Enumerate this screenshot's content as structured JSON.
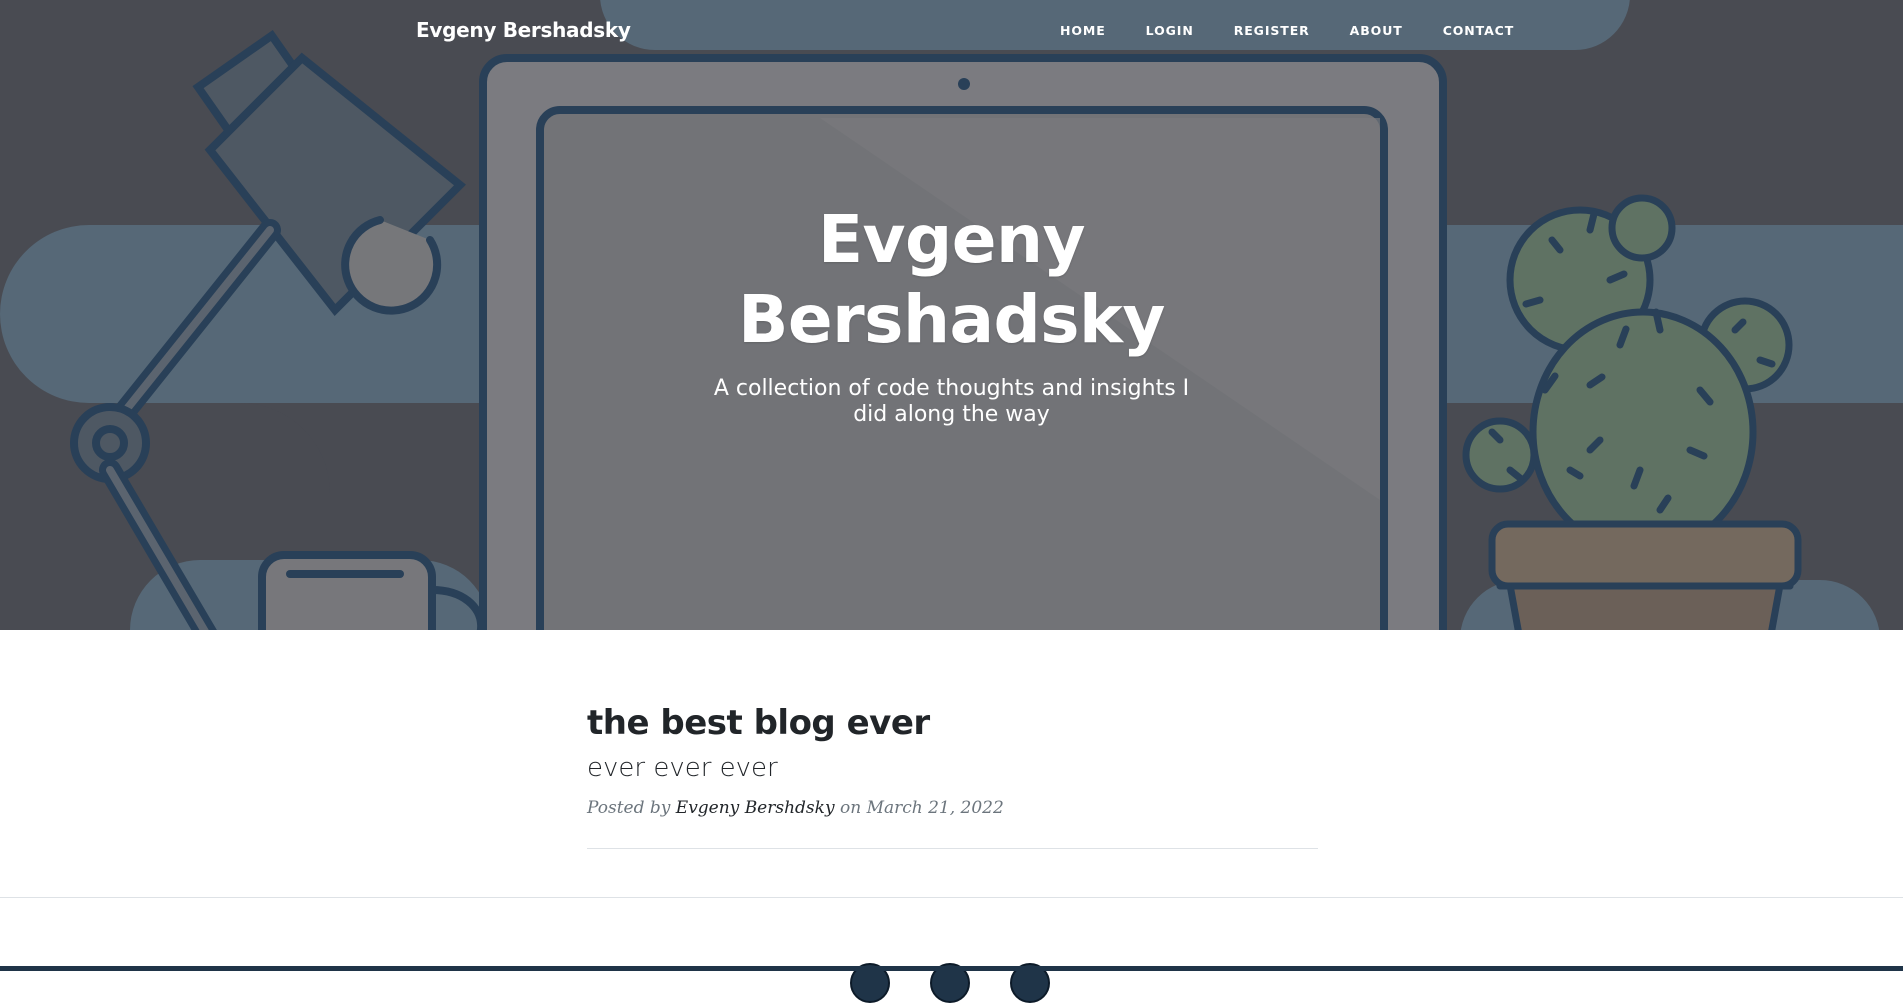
{
  "navbar": {
    "brand": "Evgeny Bershadsky",
    "links": [
      {
        "label": "HOME"
      },
      {
        "label": "LOGIN"
      },
      {
        "label": "REGISTER"
      },
      {
        "label": "ABOUT"
      },
      {
        "label": "CONTACT"
      }
    ]
  },
  "hero": {
    "title": "Evgeny Bershadsky",
    "subtitle": "A collection of code thoughts and insights I did along the way",
    "icons": [
      "desk-lamp-illustration",
      "laptop-illustration",
      "mug-illustration",
      "cactus-illustration"
    ]
  },
  "posts": [
    {
      "title": "the best blog ever",
      "subtitle": "ever ever ever",
      "meta_prefix": "Posted by",
      "author": "Evgeny Bershdsky",
      "meta_on": "on",
      "date": "March 21, 2022"
    }
  ],
  "footer": {
    "social_icons": [
      "twitter-icon",
      "facebook-icon",
      "github-icon"
    ]
  },
  "colors": {
    "hero_overlay": "#53565d",
    "accent_blue": "#63798a",
    "text_dark": "#212529",
    "text_muted": "#6c757d",
    "footer_dark": "#1f3448"
  }
}
